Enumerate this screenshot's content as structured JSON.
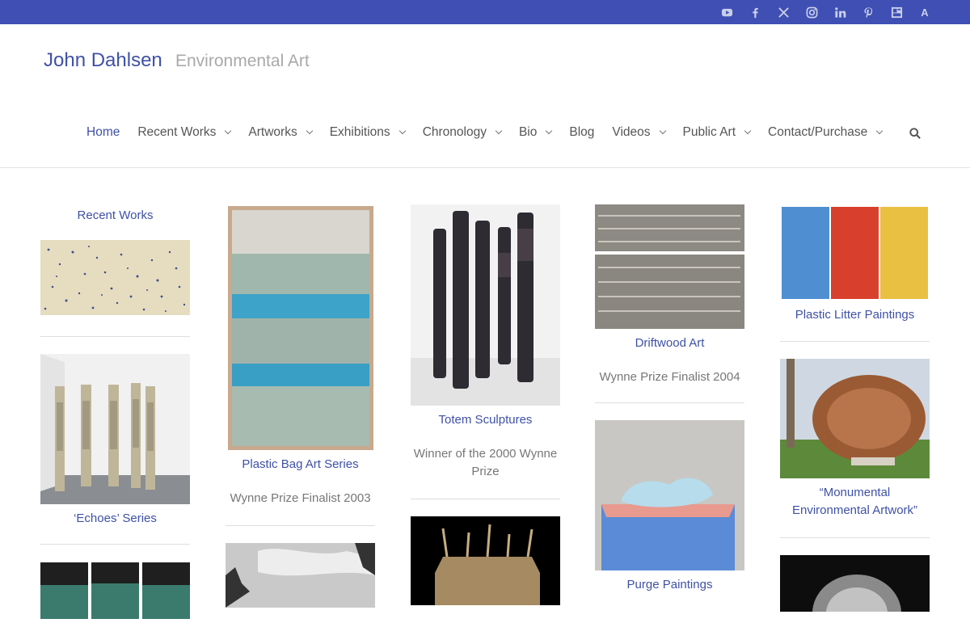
{
  "site": {
    "name": "John Dahlsen",
    "tagline": "Environmental Art"
  },
  "social_icons": [
    "youtube-icon",
    "facebook-icon",
    "x-icon",
    "instagram-icon",
    "linkedin-icon",
    "pinterest-icon",
    "rss-icon",
    "a-icon"
  ],
  "social_a_letter": "A",
  "nav": [
    {
      "label": "Home"
    },
    {
      "label": "Recent Works"
    },
    {
      "label": "Artworks"
    },
    {
      "label": "Exhibitions"
    },
    {
      "label": "Chronology"
    },
    {
      "label": "Bio"
    },
    {
      "label": "Blog"
    },
    {
      "label": "Videos"
    },
    {
      "label": "Public Art"
    },
    {
      "label": "Contact/Purchase"
    }
  ],
  "cards": {
    "recent_works": {
      "title": "Recent Works"
    },
    "echoes": {
      "title": "‘Echoes’ Series"
    },
    "plastic_bag": {
      "title": "Plastic Bag Art Series",
      "sub": "Wynne Prize Finalist 2003"
    },
    "totem": {
      "title": "Totem Sculptures",
      "sub": "Winner of the 2000 Wynne Prize"
    },
    "driftwood": {
      "title": "Driftwood Art",
      "sub": "Wynne Prize Finalist 2004"
    },
    "purge": {
      "title": "Purge Paintings"
    },
    "plastic_litter": {
      "title": "Plastic Litter Paintings"
    },
    "monumental": {
      "title": "“Monumental Environmental Artwork”"
    }
  },
  "colors": {
    "topbar": "#3f4fb4",
    "link": "#3f51a6",
    "muted": "#777777"
  }
}
